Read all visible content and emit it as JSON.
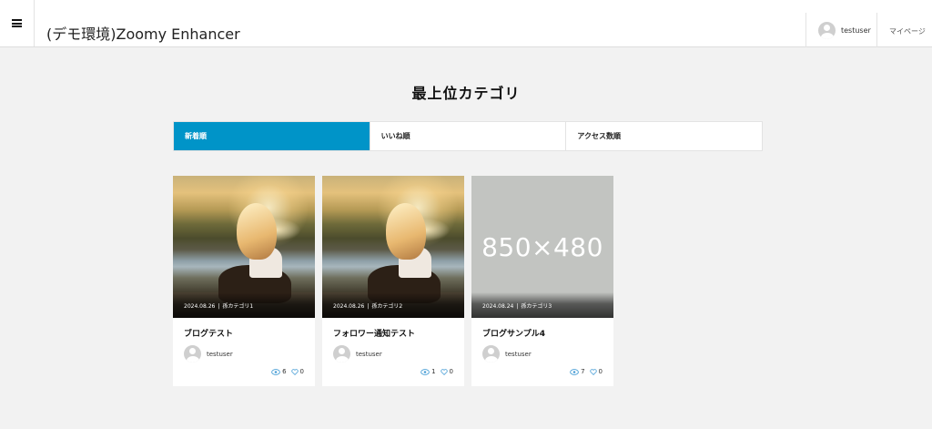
{
  "header": {
    "site_title": "(デモ環境)Zoomy Enhancer",
    "username": "testuser",
    "mypage_label": "マイページ",
    "menu_icon": "hamburger-menu-icon"
  },
  "page_title": "最上位カテゴリ",
  "tabs": [
    {
      "label": "新着順",
      "active": true
    },
    {
      "label": "いいね順",
      "active": false
    },
    {
      "label": "アクセス数順",
      "active": false
    }
  ],
  "colors": {
    "accent": "#0094c8",
    "placeholder_bg": "#c2c4c1",
    "view_icon": "#4a9fd6"
  },
  "cards": [
    {
      "date": "2024.08.26",
      "category": "孫カテゴリ1",
      "title": "ブログテスト",
      "author": "testuser",
      "views": "6",
      "likes": "0",
      "image": "photo"
    },
    {
      "date": "2024.08.26",
      "category": "孫カテゴリ2",
      "title": "フォロワー通知テスト",
      "author": "testuser",
      "views": "1",
      "likes": "0",
      "image": "photo"
    },
    {
      "date": "2024.08.24",
      "category": "孫カテゴリ3",
      "title": "ブログサンプル4",
      "author": "testuser",
      "views": "7",
      "likes": "0",
      "image": "placeholder",
      "placeholder_text": "850×480"
    }
  ]
}
